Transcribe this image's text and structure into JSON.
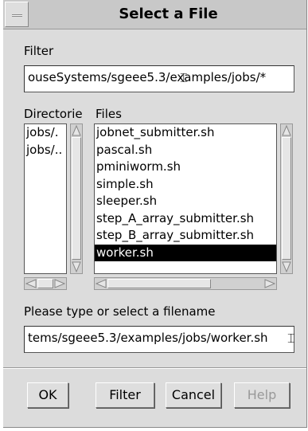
{
  "window": {
    "title": "Select a File"
  },
  "filter": {
    "label": "Filter",
    "value": "ouseSystems/sgeee5.3/examples/jobs/*"
  },
  "directories": {
    "label": "Directorie",
    "items": [
      "jobs/.",
      "jobs/.."
    ]
  },
  "files": {
    "label": "Files",
    "items": [
      "jobnet_submitter.sh",
      "pascal.sh",
      "pminiworm.sh",
      "simple.sh",
      "sleeper.sh",
      "step_A_array_submitter.sh",
      "step_B_array_submitter.sh",
      "worker.sh"
    ],
    "selected_index": 7
  },
  "filename": {
    "label": "Please type or select a filename",
    "value": "tems/sgeee5.3/examples/jobs/worker.sh"
  },
  "buttons": {
    "ok": "OK",
    "filter": "Filter",
    "cancel": "Cancel",
    "help": "Help"
  }
}
